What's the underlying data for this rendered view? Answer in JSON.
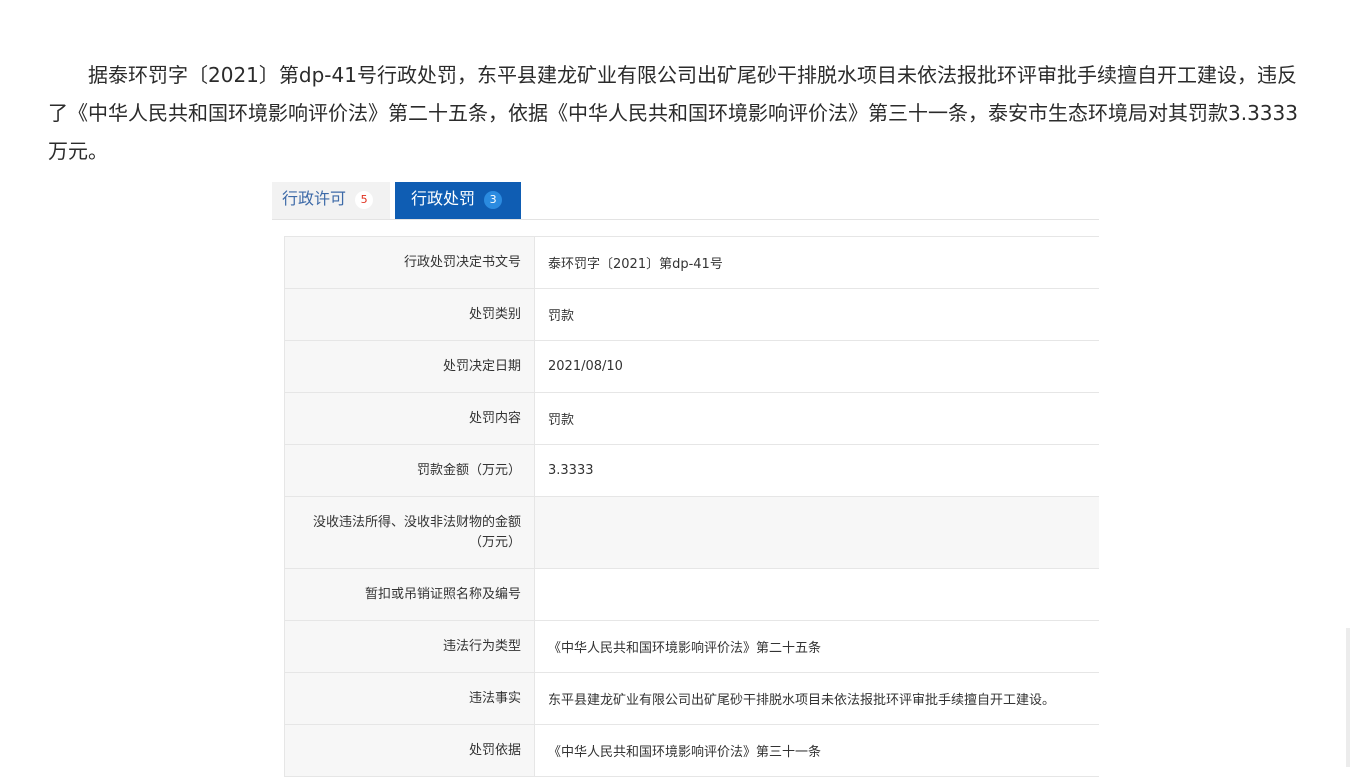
{
  "article": {
    "paragraph": "据泰环罚字〔2021〕第dp-41号行政处罚，东平县建龙矿业有限公司出矿尾砂干排脱水项目未依法报批环评审批手续擅自开工建设，违反了《中华人民共和国环境影响评价法》第二十五条，依据《中华人民共和国环境影响评价法》第三十一条，泰安市生态环境局对其罚款3.3333万元。"
  },
  "tabs": [
    {
      "label": "行政许可",
      "count": "5",
      "active": false
    },
    {
      "label": "行政处罚",
      "count": "3",
      "active": true
    }
  ],
  "details": [
    {
      "label": "行政处罚决定书文号",
      "value": "泰环罚字〔2021〕第dp-41号"
    },
    {
      "label": "处罚类别",
      "value": "罚款"
    },
    {
      "label": "处罚决定日期",
      "value": "2021/08/10"
    },
    {
      "label": "处罚内容",
      "value": "罚款"
    },
    {
      "label": "罚款金额（万元）",
      "value": "3.3333"
    },
    {
      "label": "没收违法所得、没收非法财物的金额（万元）",
      "value": ""
    },
    {
      "label": "暂扣或吊销证照名称及编号",
      "value": ""
    },
    {
      "label": "违法行为类型",
      "value": "《中华人民共和国环境影响评价法》第二十五条"
    },
    {
      "label": "违法事实",
      "value": "东平县建龙矿业有限公司出矿尾砂干排脱水项目未依法报批环评审批手续擅自开工建设。"
    },
    {
      "label": "处罚依据",
      "value": "《中华人民共和国环境影响评价法》第三十一条"
    }
  ],
  "colors": {
    "active_tab": "#0f5db3",
    "inactive_tab_text": "#3d6aa8",
    "badge_red": "#e0301e"
  }
}
